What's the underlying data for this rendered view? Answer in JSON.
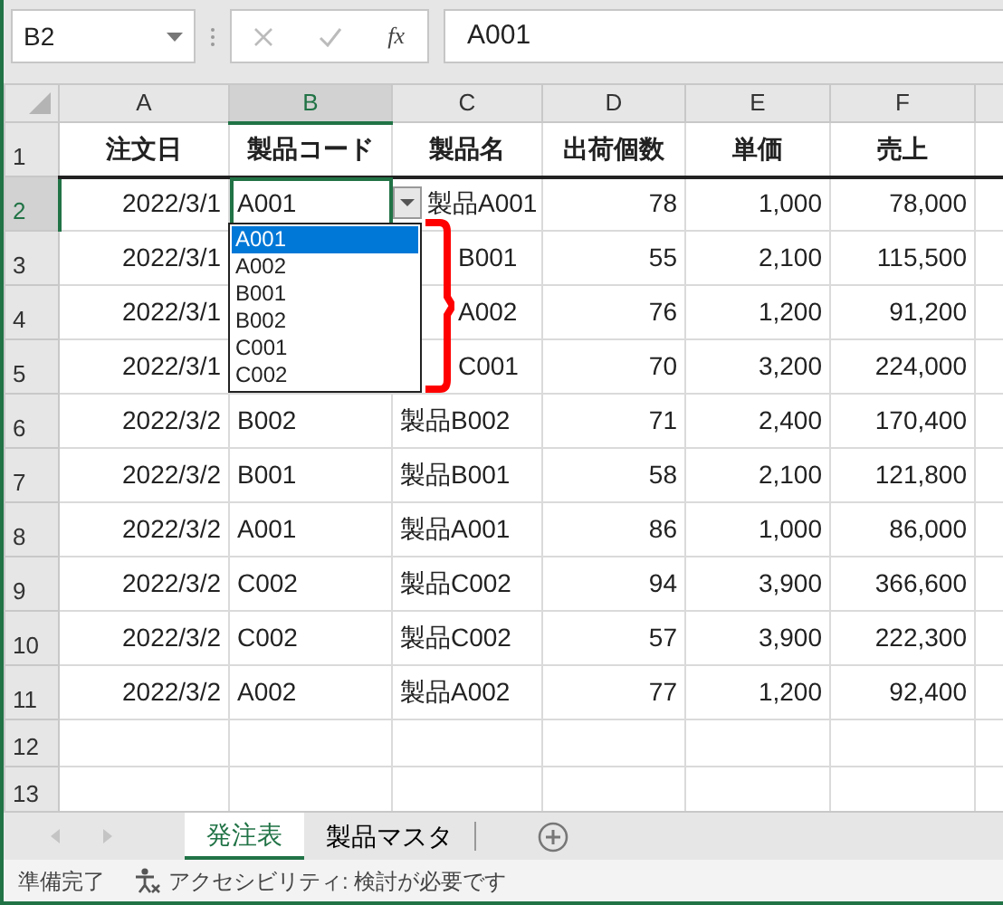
{
  "name_box": "B2",
  "formula_bar": {
    "function_label": "fx",
    "value": "A001"
  },
  "columns": [
    {
      "label": "A",
      "selected": false,
      "kind": "number"
    },
    {
      "label": "B",
      "selected": true,
      "kind": "text"
    },
    {
      "label": "C",
      "selected": false,
      "kind": "text"
    },
    {
      "label": "D",
      "selected": false,
      "kind": "number"
    },
    {
      "label": "E",
      "selected": false,
      "kind": "number"
    },
    {
      "label": "F",
      "selected": false,
      "kind": "number"
    }
  ],
  "rows": [
    {
      "label": "1",
      "selected": false,
      "kind": "header",
      "cells": [
        "注文日",
        "製品コード",
        "製品名",
        "出荷個数",
        "単価",
        "売上"
      ]
    },
    {
      "label": "2",
      "selected": true,
      "kind": "data",
      "cells": [
        "2022/3/1",
        "A001",
        "製品A001",
        "78",
        "1,000",
        "78,000"
      ]
    },
    {
      "label": "3",
      "selected": false,
      "kind": "data",
      "cells": [
        "2022/3/1",
        "",
        "B001",
        "55",
        "2,100",
        "115,500"
      ]
    },
    {
      "label": "4",
      "selected": false,
      "kind": "data",
      "cells": [
        "2022/3/1",
        "",
        "A002",
        "76",
        "1,200",
        "91,200"
      ]
    },
    {
      "label": "5",
      "selected": false,
      "kind": "data",
      "cells": [
        "2022/3/1",
        "",
        "C001",
        "70",
        "3,200",
        "224,000"
      ]
    },
    {
      "label": "6",
      "selected": false,
      "kind": "data",
      "cells": [
        "2022/3/2",
        "B002",
        "製品B002",
        "71",
        "2,400",
        "170,400"
      ]
    },
    {
      "label": "7",
      "selected": false,
      "kind": "data",
      "cells": [
        "2022/3/2",
        "B001",
        "製品B001",
        "58",
        "2,100",
        "121,800"
      ]
    },
    {
      "label": "8",
      "selected": false,
      "kind": "data",
      "cells": [
        "2022/3/2",
        "A001",
        "製品A001",
        "86",
        "1,000",
        "86,000"
      ]
    },
    {
      "label": "9",
      "selected": false,
      "kind": "data",
      "cells": [
        "2022/3/2",
        "C002",
        "製品C002",
        "94",
        "3,900",
        "366,600"
      ]
    },
    {
      "label": "10",
      "selected": false,
      "kind": "data",
      "cells": [
        "2022/3/2",
        "C002",
        "製品C002",
        "57",
        "3,900",
        "222,300"
      ]
    },
    {
      "label": "11",
      "selected": false,
      "kind": "data",
      "cells": [
        "2022/3/2",
        "A002",
        "製品A002",
        "77",
        "1,200",
        "92,400"
      ]
    },
    {
      "label": "12",
      "selected": false,
      "kind": "empty",
      "cells": []
    },
    {
      "label": "13",
      "selected": false,
      "kind": "empty",
      "cells": []
    }
  ],
  "dropdown": {
    "items": [
      {
        "label": "A001",
        "selected": true
      },
      {
        "label": "A002",
        "selected": false
      },
      {
        "label": "B001",
        "selected": false
      },
      {
        "label": "B002",
        "selected": false
      },
      {
        "label": "C001",
        "selected": false
      },
      {
        "label": "C002",
        "selected": false
      }
    ]
  },
  "sheet_tabs": [
    {
      "label": "発注表",
      "selected": true
    },
    {
      "label": "製品マスタ",
      "selected": false
    }
  ],
  "status_bar": {
    "ready": "準備完了",
    "accessibility": "アクセシビリティ: 検討が必要です"
  }
}
